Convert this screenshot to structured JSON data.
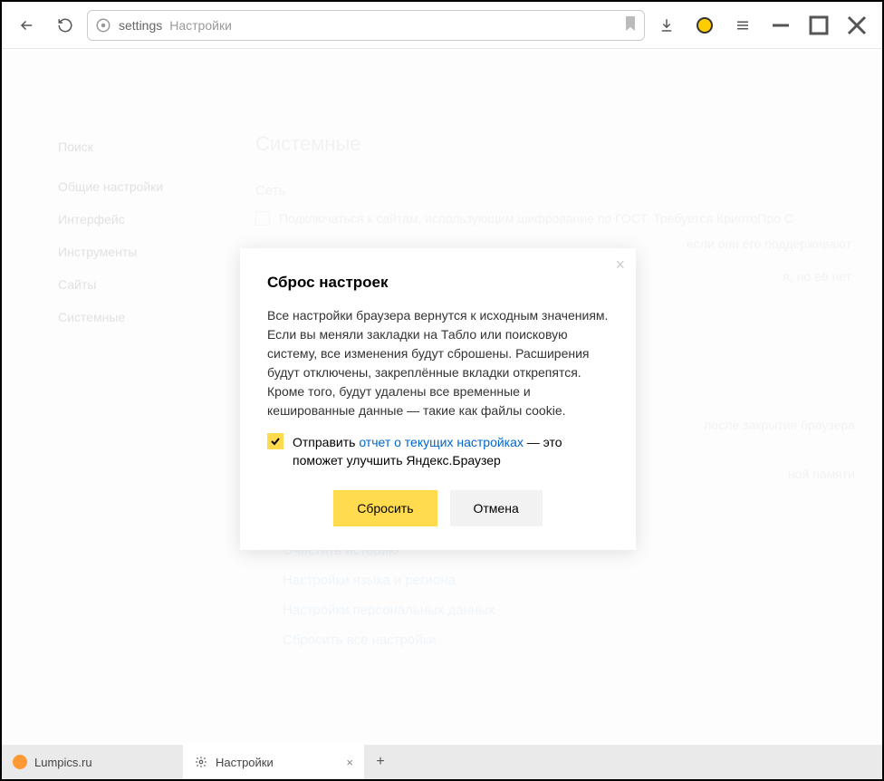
{
  "toolbar": {
    "address_prefix": "settings",
    "address_title": "Настройки"
  },
  "sidebar": {
    "search": "Поиск",
    "items": [
      {
        "label": "Общие настройки"
      },
      {
        "label": "Интерфейс"
      },
      {
        "label": "Инструменты"
      },
      {
        "label": "Сайты"
      },
      {
        "label": "Системные"
      }
    ]
  },
  "main": {
    "title": "Системные",
    "section_network": "Сеть",
    "opt_gost": "Подключаться к сайтам, использующим шифрование по ГОСТ. Требуется КриптоПро C",
    "opt_support_tail": "если они его поддерживают",
    "opt_nobut_tail": "я, но её нет",
    "opt_after_close_tail": "после закрытия браузера",
    "opt_memory_tail": "ной памяти",
    "links": [
      "Очистить историю",
      "Настройки языка и региона",
      "Настройки персональных данных",
      "Сбросить все настройки"
    ]
  },
  "dialog": {
    "title": "Сброс настроек",
    "body": "Все настройки браузера вернутся к исходным значениям. Если вы меняли закладки на Табло или поисковую систему, все изменения будут сброшены. Расширения будут отключены, закреплённые вкладки открепятся. Кроме того, будут удалены все временные и кешированные данные — такие как файлы cookie.",
    "send_prefix": "Отправить ",
    "send_link": "отчет о текущих настройках",
    "send_suffix": " — это поможет улучшить Яндекс.Браузер",
    "primary": "Сбросить",
    "secondary": "Отмена",
    "close": "×"
  },
  "tabs": {
    "t1": "Lumpics.ru",
    "t2": "Настройки",
    "close": "×",
    "plus": "+"
  }
}
